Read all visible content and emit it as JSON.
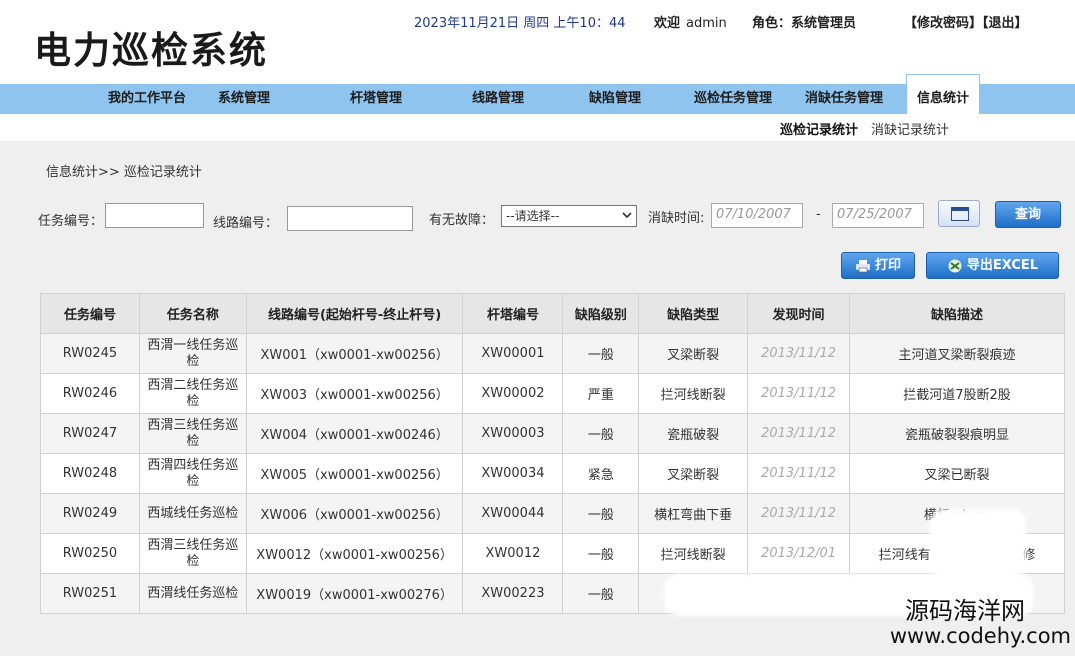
{
  "app": {
    "title": "电力巡检系统",
    "datetime": "2023年11月21日 周四 上午10：44",
    "welcome_label": "欢迎",
    "username": "admin",
    "role_text": "角色：系统管理员",
    "change_password": "【修改密码】",
    "logout": "【退出】"
  },
  "nav": {
    "items": [
      {
        "label": "我的工作平台"
      },
      {
        "label": "系统管理"
      },
      {
        "label": "杆塔管理"
      },
      {
        "label": "线路管理"
      },
      {
        "label": "缺陷管理"
      },
      {
        "label": "巡检任务管理"
      },
      {
        "label": "消缺任务管理"
      },
      {
        "label": "信息统计",
        "active": true
      }
    ],
    "sub": [
      {
        "label": "巡检记录统计",
        "active": true
      },
      {
        "label": "消缺记录统计"
      }
    ]
  },
  "breadcrumb": "信息统计>> 巡检记录统计",
  "filters": {
    "task_no_label": "任务编号：",
    "task_no_value": "",
    "line_no_label": "线路编号：",
    "line_no_value": "",
    "fault_label": "有无故障：",
    "fault_selected": "--请选择--",
    "time_label": "消缺时间:",
    "date_from": "07/10/2007",
    "date_sep": "-",
    "date_to": "07/25/2007",
    "query_button": "查询",
    "print_button": "打印",
    "export_button": "导出EXCEL"
  },
  "table": {
    "headers": [
      "任务编号",
      "任务名称",
      "线路编号(起始杆号-终止杆号)",
      "杆塔编号",
      "缺陷级别",
      "缺陷类型",
      "发现时间",
      "缺陷描述"
    ],
    "rows": [
      [
        "RW0245",
        "西渭一线任务巡检",
        "XW001（xw0001-xw00256）",
        "XW00001",
        "一般",
        "叉梁断裂",
        "2013/11/12",
        "主河道叉梁断裂痕迹"
      ],
      [
        "RW0246",
        "西渭二线任务巡检",
        "XW003（xw0001-xw00256）",
        "XW00002",
        "严重",
        "拦河线断裂",
        "2013/11/12",
        "拦截河道7股断2股"
      ],
      [
        "RW0247",
        "西渭三线任务巡检",
        "XW004（xw0001-xw00246）",
        "XW00003",
        "一般",
        "瓷瓶破裂",
        "2013/11/12",
        "瓷瓶破裂裂痕明显"
      ],
      [
        "RW0248",
        "西渭四线任务巡检",
        "XW005（xw0001-xw00256）",
        "XW00034",
        "紧急",
        "叉梁断裂",
        "2013/11/12",
        "叉梁已断裂"
      ],
      [
        "RW0249",
        "西城线任务巡检",
        "XW006（xw0001-xw00256）",
        "XW00044",
        "一般",
        "横杠弯曲下垂",
        "2013/11/12",
        "横杠mbsp;"
      ],
      [
        "RW0250",
        "西渭三线任务巡检",
        "XW0012（xw0001-xw00256）",
        "XW0012",
        "一般",
        "拦河线断裂",
        "2013/12/01",
        "拦河线有                   检修"
      ],
      [
        "RW0251",
        "西渭线任务巡检",
        "XW0019（xw0001-xw00276）",
        "XW00223",
        "一般",
        "",
        "",
        ""
      ]
    ]
  },
  "watermark": {
    "line1": "源码海洋网",
    "line2": "www.codehy.com"
  }
}
